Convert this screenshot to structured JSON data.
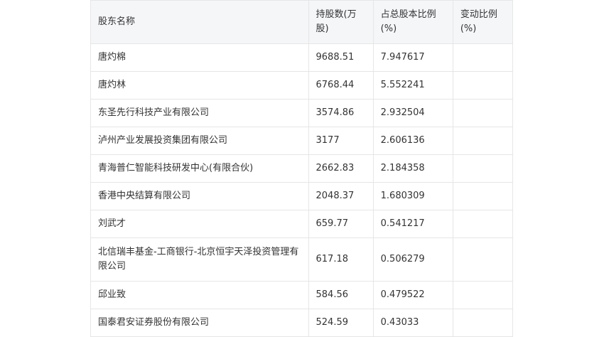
{
  "table": {
    "headers": {
      "name": "股东名称",
      "shares": "持股数(万股)",
      "ratio": "占总股本比例(%)",
      "change": "变动比例(%)"
    },
    "rows": [
      {
        "name": "唐灼棉",
        "shares": "9688.51",
        "ratio": "7.947617",
        "change": ""
      },
      {
        "name": "唐灼林",
        "shares": "6768.44",
        "ratio": "5.552241",
        "change": ""
      },
      {
        "name": "东圣先行科技产业有限公司",
        "shares": "3574.86",
        "ratio": "2.932504",
        "change": ""
      },
      {
        "name": "泸州产业发展投资集团有限公司",
        "shares": "3177",
        "ratio": "2.606136",
        "change": ""
      },
      {
        "name": "青海普仁智能科技研发中心(有限合伙)",
        "shares": "2662.83",
        "ratio": "2.184358",
        "change": ""
      },
      {
        "name": "香港中央结算有限公司",
        "shares": "2048.37",
        "ratio": "1.680309",
        "change": ""
      },
      {
        "name": "刘武才",
        "shares": "659.77",
        "ratio": "0.541217",
        "change": ""
      },
      {
        "name": "北信瑞丰基金-工商银行-北京恒宇天泽投资管理有限公司",
        "shares": "617.18",
        "ratio": "0.506279",
        "change": ""
      },
      {
        "name": "邱业致",
        "shares": "584.56",
        "ratio": "0.479522",
        "change": ""
      },
      {
        "name": "国泰君安证券股份有限公司",
        "shares": "524.59",
        "ratio": "0.43033",
        "change": ""
      }
    ]
  }
}
